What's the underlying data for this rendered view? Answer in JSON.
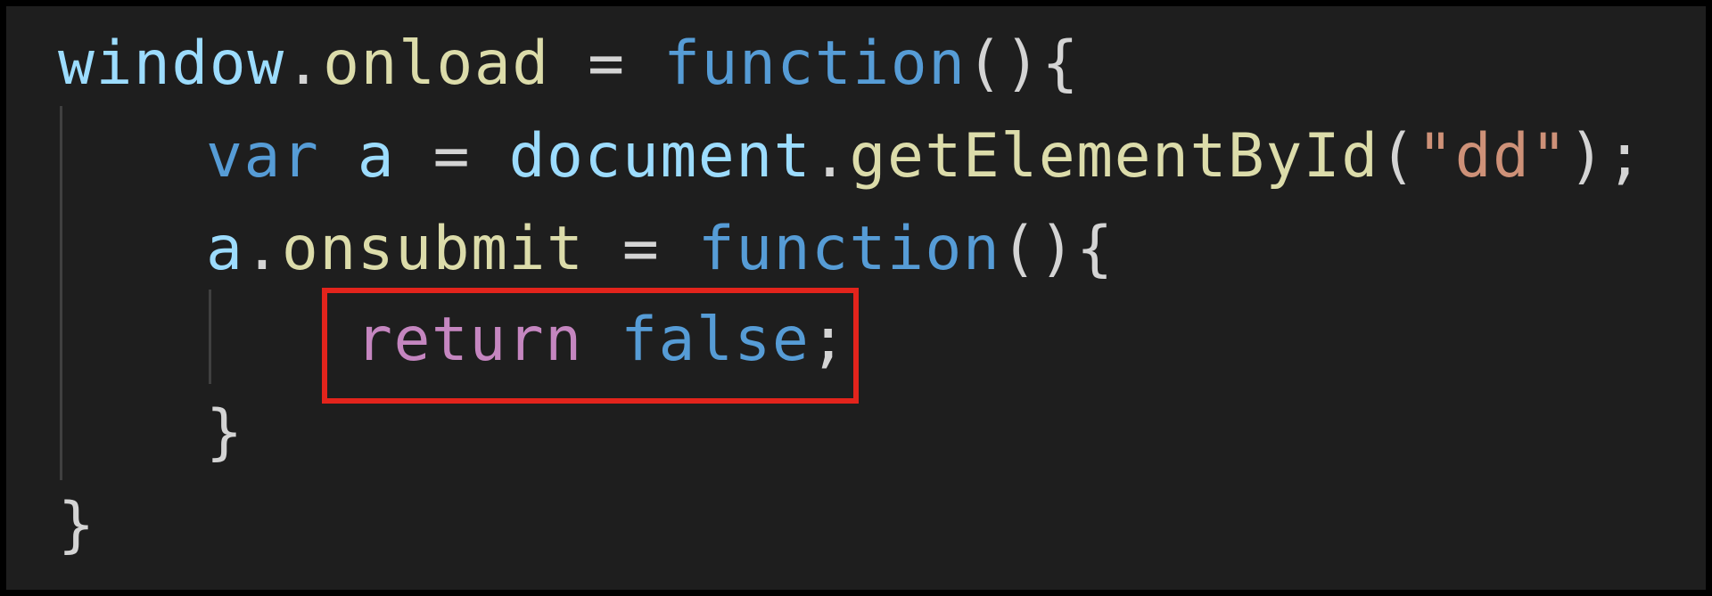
{
  "colors": {
    "background": "#1e1e1e",
    "outer_frame": "#000000",
    "indent_guide": "#404040",
    "highlight_border": "#e3241c",
    "variable": "#9cdcfe",
    "method": "#dcdcaa",
    "keyword": "#569cd6",
    "control_keyword": "#c586c0",
    "string": "#ce9178",
    "punctuation": "#d4d4d4"
  },
  "code": {
    "language": "javascript",
    "lines": [
      {
        "tokens": [
          {
            "text": "window",
            "kind": "variable"
          },
          {
            "text": ".",
            "kind": "punctuation"
          },
          {
            "text": "onload",
            "kind": "method"
          },
          {
            "text": " = ",
            "kind": "punctuation"
          },
          {
            "text": "function",
            "kind": "keyword"
          },
          {
            "text": "(){",
            "kind": "punctuation"
          }
        ]
      },
      {
        "tokens": [
          {
            "text": "var",
            "kind": "keyword"
          },
          {
            "text": " ",
            "kind": "punctuation"
          },
          {
            "text": "a",
            "kind": "variable"
          },
          {
            "text": " = ",
            "kind": "punctuation"
          },
          {
            "text": "document",
            "kind": "variable"
          },
          {
            "text": ".",
            "kind": "punctuation"
          },
          {
            "text": "getElementById",
            "kind": "method"
          },
          {
            "text": "(",
            "kind": "punctuation"
          },
          {
            "text": "\"dd\"",
            "kind": "string"
          },
          {
            "text": ");",
            "kind": "punctuation"
          }
        ]
      },
      {
        "tokens": [
          {
            "text": "a",
            "kind": "variable"
          },
          {
            "text": ".",
            "kind": "punctuation"
          },
          {
            "text": "onsubmit",
            "kind": "method"
          },
          {
            "text": " = ",
            "kind": "punctuation"
          },
          {
            "text": "function",
            "kind": "keyword"
          },
          {
            "text": "(){",
            "kind": "punctuation"
          }
        ]
      },
      {
        "tokens": [
          {
            "text": "return",
            "kind": "control_keyword"
          },
          {
            "text": " ",
            "kind": "punctuation"
          },
          {
            "text": "false",
            "kind": "keyword"
          },
          {
            "text": ";",
            "kind": "punctuation"
          }
        ]
      },
      {
        "tokens": [
          {
            "text": "}",
            "kind": "punctuation"
          }
        ]
      },
      {
        "tokens": [
          {
            "text": "}",
            "kind": "punctuation"
          }
        ]
      }
    ]
  }
}
